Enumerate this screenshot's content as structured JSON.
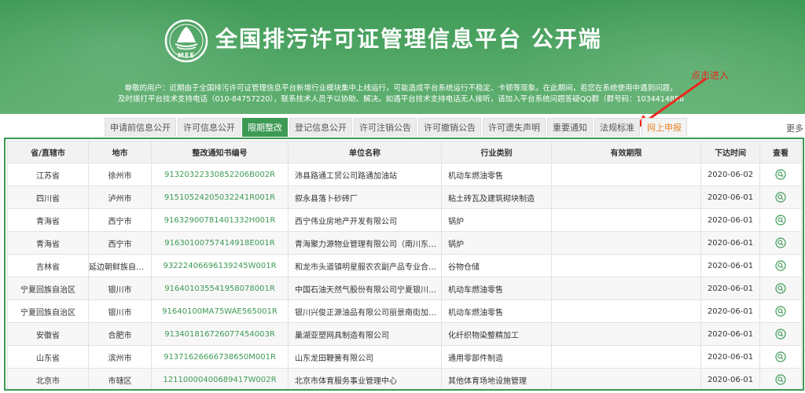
{
  "header": {
    "title": "全国排污许可证管理信息平台  公开端",
    "logo_text": "MEE",
    "notice_line1": "尊敬的用户：近期由于全国排污许可证管理信息平台新增行业模块集中上线运行，可能造成平台系统运行不稳定、卡顿等现象。在此期间，若您在系统使用中遇到问题，",
    "notice_line2": "及时拨打平台技术支持电话（010-84757220），联系技术人员予以协助、解决。如遇平台技术支持电话无人接听，请加入平台系统问题答疑QQ群（群号码：1034414856）"
  },
  "annotation": {
    "text": "点击进入",
    "color": "#e8281c"
  },
  "tabs": [
    {
      "label": "申请前信息公开"
    },
    {
      "label": "许可信息公开"
    },
    {
      "label": "限期整改",
      "active": true
    },
    {
      "label": "登记信息公开"
    },
    {
      "label": "许可注销公告"
    },
    {
      "label": "许可撤销公告"
    },
    {
      "label": "许可遗失声明"
    },
    {
      "label": "重要通知"
    },
    {
      "label": "法规标准"
    },
    {
      "label": "网上申报"
    }
  ],
  "more_label": "更多",
  "table": {
    "columns": [
      "省/直辖市",
      "地市",
      "整改通知书编号",
      "单位名称",
      "行业类别",
      "有效期限",
      "下达时间",
      "查看"
    ],
    "rows": [
      [
        "江苏省",
        "徐州市",
        "91320322330852206B002R",
        "沛县路通工贸公司路通加油站",
        "机动车燃油零售",
        "",
        "2020-06-02"
      ],
      [
        "四川省",
        "泸州市",
        "91510524205032241R001R",
        "叙永县落卜砂砖厂",
        "粘土砖瓦及建筑砌块制造",
        "",
        "2020-06-01"
      ],
      [
        "青海省",
        "西宁市",
        "91632900781401332H001R",
        "西宁伟业房地产开发有限公司",
        "锅炉",
        "",
        "2020-06-01"
      ],
      [
        "青海省",
        "西宁市",
        "91630100757414918E001R",
        "青海聚力源物业管理有限公司（南川东路77...",
        "锅炉",
        "",
        "2020-06-01"
      ],
      [
        "吉林省",
        "延边朝鲜族自治州",
        "93222406696139245W001R",
        "和龙市头道镇明星服农农副产品专业合作社",
        "谷物仓储",
        "",
        "2020-06-01"
      ],
      [
        "宁夏回族自治区",
        "银川市",
        "91640103554195807800​1R",
        "中国石油天然气股份有限公司宁夏银川销售...",
        "机动车燃油零售",
        "",
        "2020-06-01"
      ],
      [
        "宁夏回族自治区",
        "银川市",
        "91640100MA75WAE565001R",
        "银川兴俊正源油品有限公司丽景南街加油站",
        "机动车燃油零售",
        "",
        "2020-06-01"
      ],
      [
        "安徽省",
        "合肥市",
        "91340181672607745400​3R",
        "巢湖亚塑网具制造有限公司",
        "化纤织物染整精加工",
        "",
        "2020-06-01"
      ],
      [
        "山东省",
        "滨州市",
        "91371626666738650M001R",
        "山东龙田鞭簧有限公司",
        "通用零部件制造",
        "",
        "2020-06-01"
      ],
      [
        "北京市",
        "市辖区",
        "12110000400689417W002R",
        "北京市体育服务事业管理中心",
        "其他体育场地设施管理",
        "",
        "2020-06-01"
      ]
    ]
  },
  "colors": {
    "brand_green": "#3d9a54",
    "link_green": "#3d9a54",
    "annotation_red": "#e8281c",
    "report_orange": "#e8842a"
  }
}
